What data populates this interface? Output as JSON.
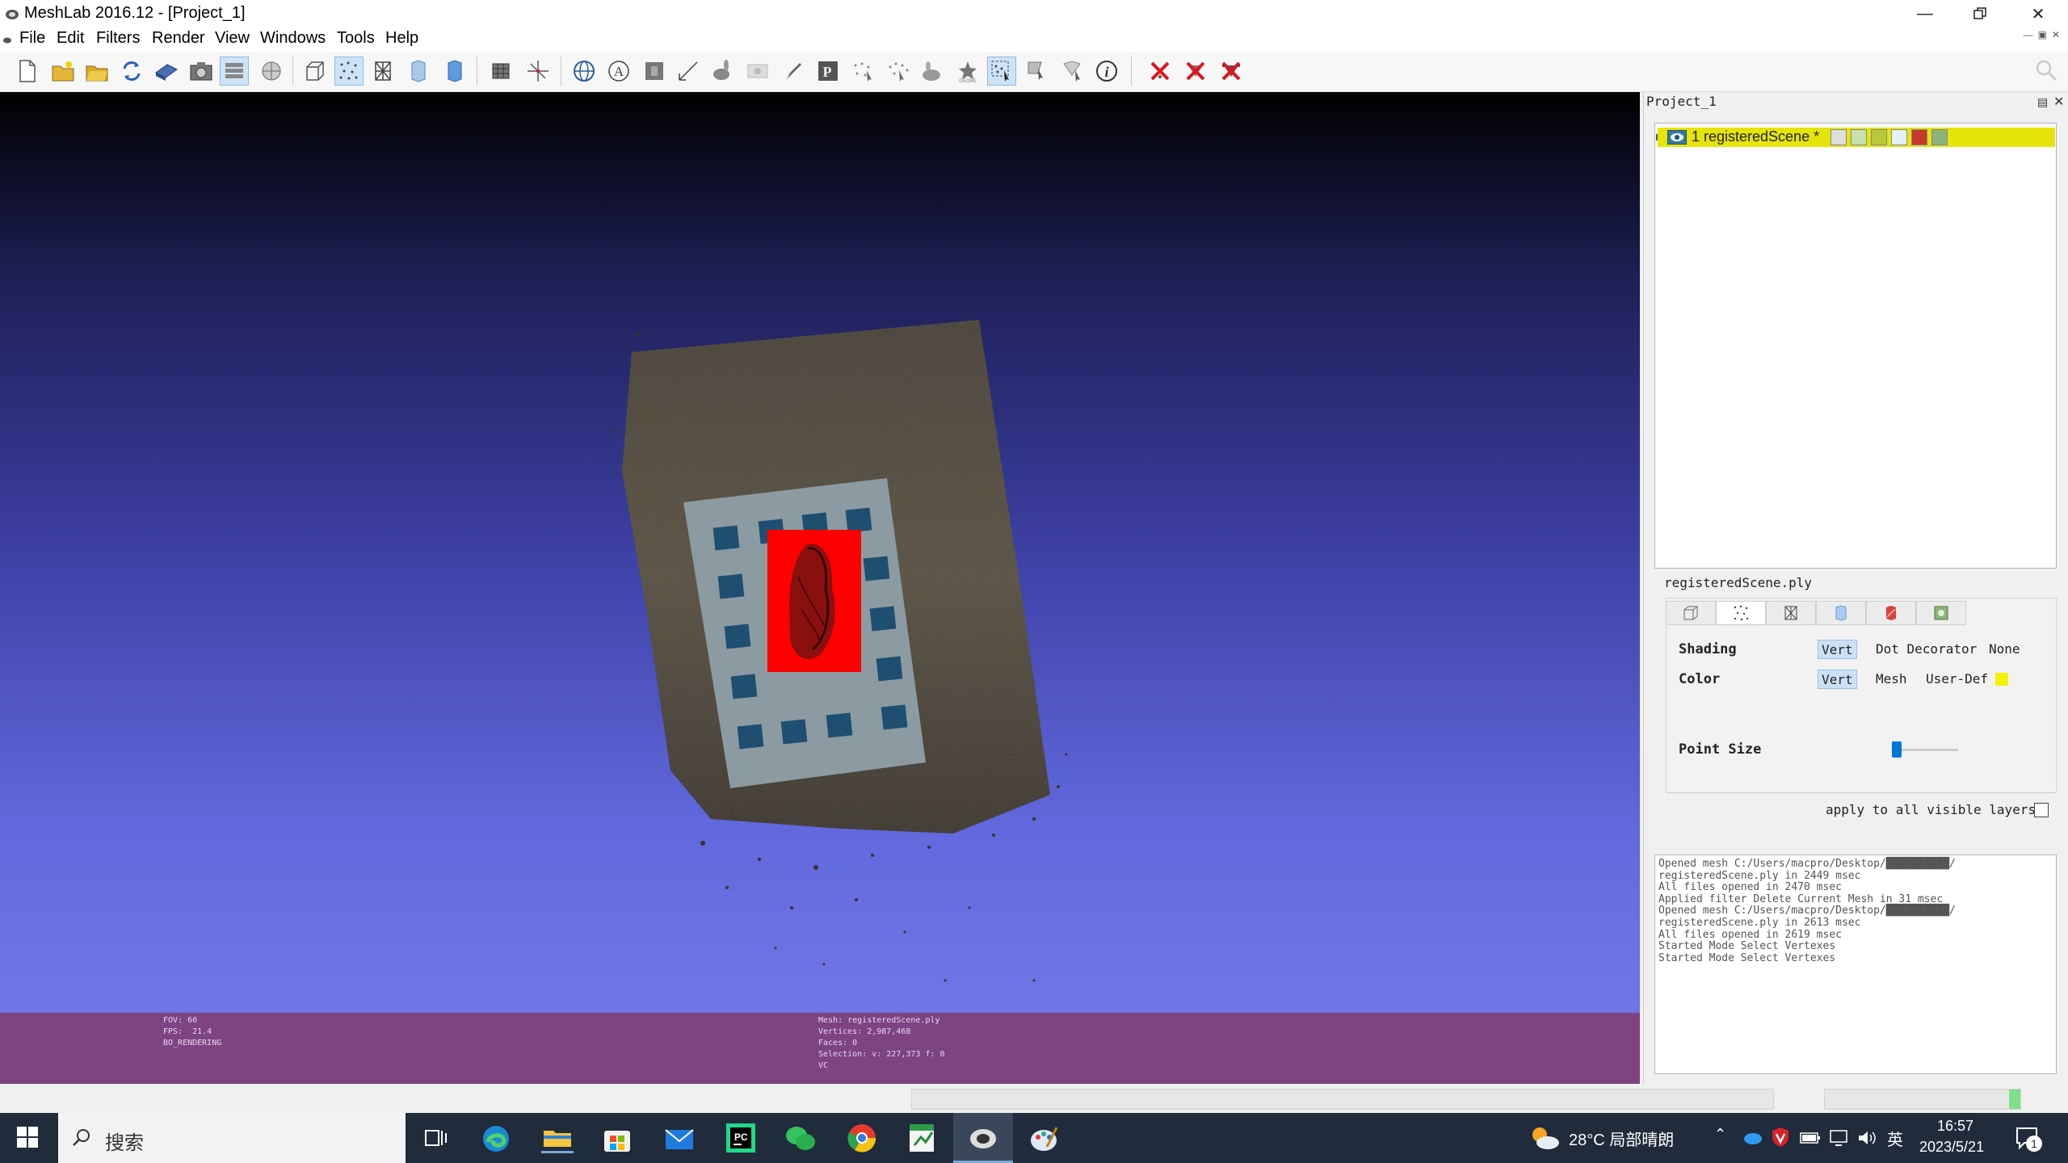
{
  "window": {
    "title": "MeshLab 2016.12 - [Project_1]",
    "controls": [
      "minimize",
      "restore",
      "close"
    ]
  },
  "menu": [
    "File",
    "Edit",
    "Filters",
    "Render",
    "View",
    "Windows",
    "Tools",
    "Help"
  ],
  "toolbar": {
    "active_tools": [
      "layer-dialog",
      "points-render",
      "select-vertexes"
    ]
  },
  "viewport": {
    "info_left": "FOV: 60\nFPS:  21.4\nBO_RENDERING",
    "info_center": "Mesh: registeredScene.ply\nVertices: 2,987,468\nFaces: 0\nSelection: v: 227,373 f: 0\nVC"
  },
  "layers": {
    "panel_title": "Project_1",
    "items": [
      {
        "label": "1 registeredScene *"
      }
    ]
  },
  "render_settings": {
    "mesh_name": "registeredScene.ply",
    "shading": {
      "label": "Shading",
      "options": [
        "Vert",
        "Dot Decorator",
        "None"
      ],
      "selected": "Vert"
    },
    "color": {
      "label": "Color",
      "options": [
        "Vert",
        "Mesh",
        "User-Def"
      ],
      "selected": "Vert",
      "user_def_color": "#f5f000"
    },
    "point_size": {
      "label": "Point Size",
      "value": 0.05
    },
    "apply_all": "apply to all visible layers"
  },
  "log": [
    "Opened mesh C:/Users/macpro/Desktop/██████████/",
    "registeredScene.ply in 2449 msec",
    "All files opened in 2470 msec",
    "Applied filter Delete Current Mesh in 31 msec",
    "Opened mesh C:/Users/macpro/Desktop/██████████/",
    "registeredScene.ply in 2613 msec",
    "All files opened in 2619 msec",
    "Started Mode Select Vertexes",
    "Started Mode Select Vertexes"
  ],
  "taskbar": {
    "search_placeholder": "搜索",
    "weather": "28°C  局部晴朗",
    "ime": "英",
    "time": "16:57",
    "date": "2023/5/21",
    "notifications": "1"
  },
  "colors": {
    "selection_red": "#ff0000",
    "layer_highlight": "#e6e40b",
    "info_bar": "#7d4383"
  }
}
